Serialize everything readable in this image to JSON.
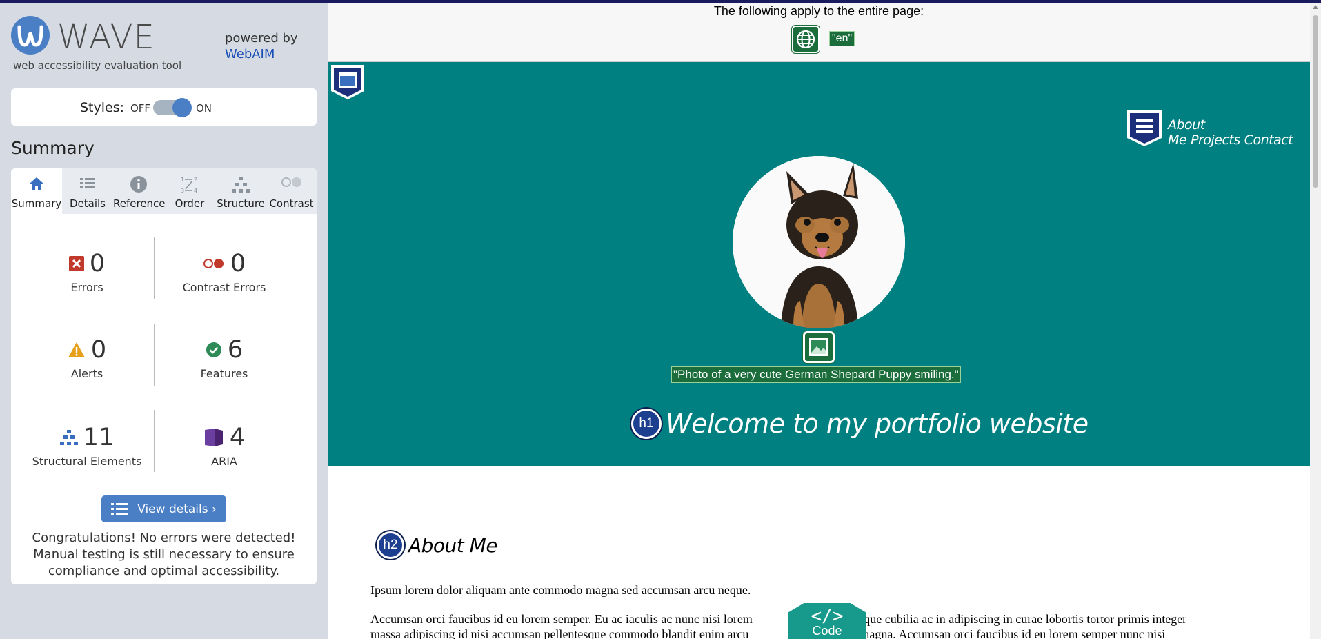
{
  "wave": {
    "logo_word": "WAVE",
    "logo_sub": "web accessibility evaluation tool",
    "powered_by": "powered by",
    "webaim_link": "WebAIM",
    "styles_label": "Styles:",
    "styles_off": "OFF",
    "styles_on": "ON",
    "styles_state": "on",
    "summary_title": "Summary",
    "tabs": [
      {
        "label": "Summary",
        "icon": "home-icon",
        "active": true
      },
      {
        "label": "Details",
        "icon": "list-icon",
        "active": false
      },
      {
        "label": "Reference",
        "icon": "info-icon",
        "active": false
      },
      {
        "label": "Order",
        "icon": "order-icon",
        "active": false
      },
      {
        "label": "Structure",
        "icon": "structure-icon",
        "active": false
      },
      {
        "label": "Contrast",
        "icon": "contrast-icon",
        "active": false
      }
    ],
    "counts": {
      "errors": {
        "value": "0",
        "label": "Errors",
        "color": "#c0392b"
      },
      "contrast_errors": {
        "value": "0",
        "label": "Contrast Errors",
        "color": "#c0392b"
      },
      "alerts": {
        "value": "0",
        "label": "Alerts",
        "color": "#e6a019"
      },
      "features": {
        "value": "6",
        "label": "Features",
        "color": "#2e8b57"
      },
      "structural": {
        "value": "11",
        "label": "Structural Elements",
        "color": "#3a6fbf"
      },
      "aria": {
        "value": "4",
        "label": "ARIA",
        "color": "#5b2e8c"
      }
    },
    "view_details": "View details ›",
    "congrats": "Congratulations! No errors were detected! Manual testing is still necessary to ensure compliance and optimal accessibility."
  },
  "page": {
    "applies_text": "The following apply to the entire page:",
    "lang_tag": "\"en\"",
    "nav": [
      "About Me",
      "Projects",
      "Contact"
    ],
    "alt_text": "\"Photo of a very cute German Shepard Puppy smiling.\"",
    "h1_badge": "h1",
    "h1": "Welcome to my portfolio website",
    "h2_badge": "h2",
    "h2": "About Me",
    "para1": "Ipsum lorem dolor aliquam ante commodo magna sed accumsan arcu neque.",
    "para2_line1": "Accumsan orci faucibus id eu lorem semper. Eu ac iaculis ac nunc nisi lorem",
    "para2_line1b": "rem neque cubilia ac in adipiscing in curae lobortis tortor primis integer",
    "para2_line2": "massa adipiscing id nisi accumsan pellentesque commodo blandit enim arcu",
    "para2_line2b": "d arcu magna. Accumsan orci faucibus id eu lorem semper nunc nisi",
    "code_glyph": "</>",
    "code_label": "Code"
  },
  "colors": {
    "sidebar_bg": "#d6dbe3",
    "accent_blue": "#4a7fc6",
    "hero_teal": "#008080",
    "wave_green": "#1b6e3b"
  }
}
